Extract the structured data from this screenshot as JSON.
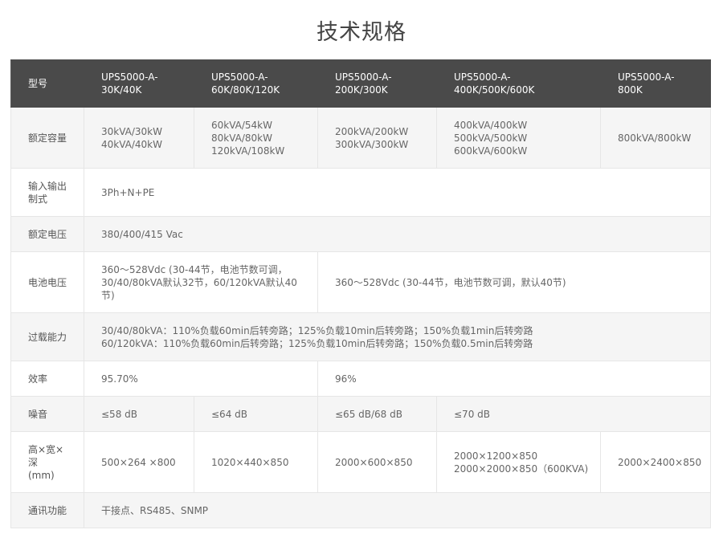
{
  "title": "技术规格",
  "table": {
    "headers": [
      "型号",
      "UPS5000-A-\n30K/40K",
      "UPS5000-A-\n60K/80K/120K",
      "UPS5000-A-\n200K/300K",
      "UPS5000-A-\n400K/500K/600K",
      "UPS5000-A-\n800K"
    ],
    "rows": {
      "rated_capacity": {
        "label": "额定容量",
        "values": [
          "30kVA/30kW\n40kVA/40kW",
          "60kVA/54kW\n80kVA/80kW\n120kVA/108kW",
          "200kVA/200kW\n300kVA/300kW",
          "400kVA/400kW\n500kVA/500kW\n600kVA/600kW",
          "800kVA/800kW"
        ]
      },
      "io_system": {
        "label": "输入输出\n制式",
        "value": "3Ph+N+PE"
      },
      "rated_voltage": {
        "label": "额定电压",
        "value": "380/400/415 Vac"
      },
      "battery_voltage": {
        "label": "电池电压",
        "values": [
          "360～528Vdc (30-44节，电池节数可调，\n30/40/80kVA默认32节，60/120kVA默认40\n节)",
          "360～528Vdc (30-44节，电池节数可调，默认40节)"
        ]
      },
      "overload": {
        "label": "过载能力",
        "value": "30/40/80kVA：110%负载60min后转旁路；125%负载10min后转旁路；150%负载1min后转旁路\n60/120kVA：110%负载60min后转旁路；125%负载10min后转旁路；150%负载0.5min后转旁路"
      },
      "efficiency": {
        "label": "效率",
        "values": [
          "95.70%",
          "96%"
        ]
      },
      "noise": {
        "label": "噪音",
        "values": [
          "≤58 dB",
          "≤64 dB",
          "≤65 dB/68 dB",
          "≤70 dB"
        ]
      },
      "dimensions": {
        "label": "高×宽×\n深\n(mm)",
        "values": [
          "500×264 ×800",
          "1020×440×850",
          "2000×600×850",
          "2000×1200×850\n2000×2000×850（600KVA)",
          "2000×2400×850"
        ]
      },
      "communication": {
        "label": "通讯功能",
        "value": "干接点、RS485、SNMP"
      }
    }
  },
  "colors": {
    "header_bg": "#4a4a4a",
    "header_text": "#ffffff",
    "row_alt_bg": "#f5f5f5",
    "text": "#666666",
    "title": "#444444"
  }
}
